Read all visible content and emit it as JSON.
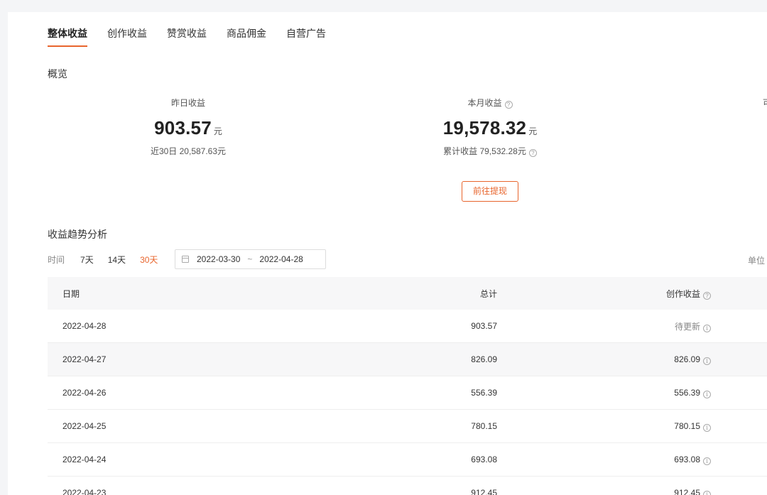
{
  "tabs": [
    {
      "label": "整体收益",
      "active": true
    },
    {
      "label": "创作收益",
      "active": false
    },
    {
      "label": "赞赏收益",
      "active": false
    },
    {
      "label": "商品佣金",
      "active": false
    },
    {
      "label": "自营广告",
      "active": false
    }
  ],
  "overview": {
    "title": "概览",
    "yesterday": {
      "label": "昨日收益",
      "value": "903.57",
      "unit": "元",
      "sub": "近30日 20,587.63元"
    },
    "month": {
      "label": "本月收益",
      "value": "19,578.32",
      "unit": "元",
      "sub": "累计收益 79,532.28元"
    },
    "third_label_partial": "可",
    "withdraw_button": "前往提现"
  },
  "trend": {
    "title": "收益趋势分析",
    "time_label": "时间",
    "ranges": [
      {
        "label": "7天",
        "active": false
      },
      {
        "label": "14天",
        "active": false
      },
      {
        "label": "30天",
        "active": true
      }
    ],
    "date_start": "2022-03-30",
    "date_sep": "~",
    "date_end": "2022-04-28",
    "unit_label": "单位"
  },
  "table": {
    "headers": {
      "date": "日期",
      "total": "总计",
      "create": "创作收益"
    },
    "rows": [
      {
        "date": "2022-04-28",
        "total": "903.57",
        "create": "待更新",
        "pending": true
      },
      {
        "date": "2022-04-27",
        "total": "826.09",
        "create": "826.09",
        "pending": false
      },
      {
        "date": "2022-04-26",
        "total": "556.39",
        "create": "556.39",
        "pending": false
      },
      {
        "date": "2022-04-25",
        "total": "780.15",
        "create": "780.15",
        "pending": false
      },
      {
        "date": "2022-04-24",
        "total": "693.08",
        "create": "693.08",
        "pending": false
      },
      {
        "date": "2022-04-23",
        "total": "912.45",
        "create": "912.45",
        "pending": false
      }
    ]
  },
  "colors": {
    "accent": "#e8652d",
    "header_bg": "#f7f7f8"
  }
}
